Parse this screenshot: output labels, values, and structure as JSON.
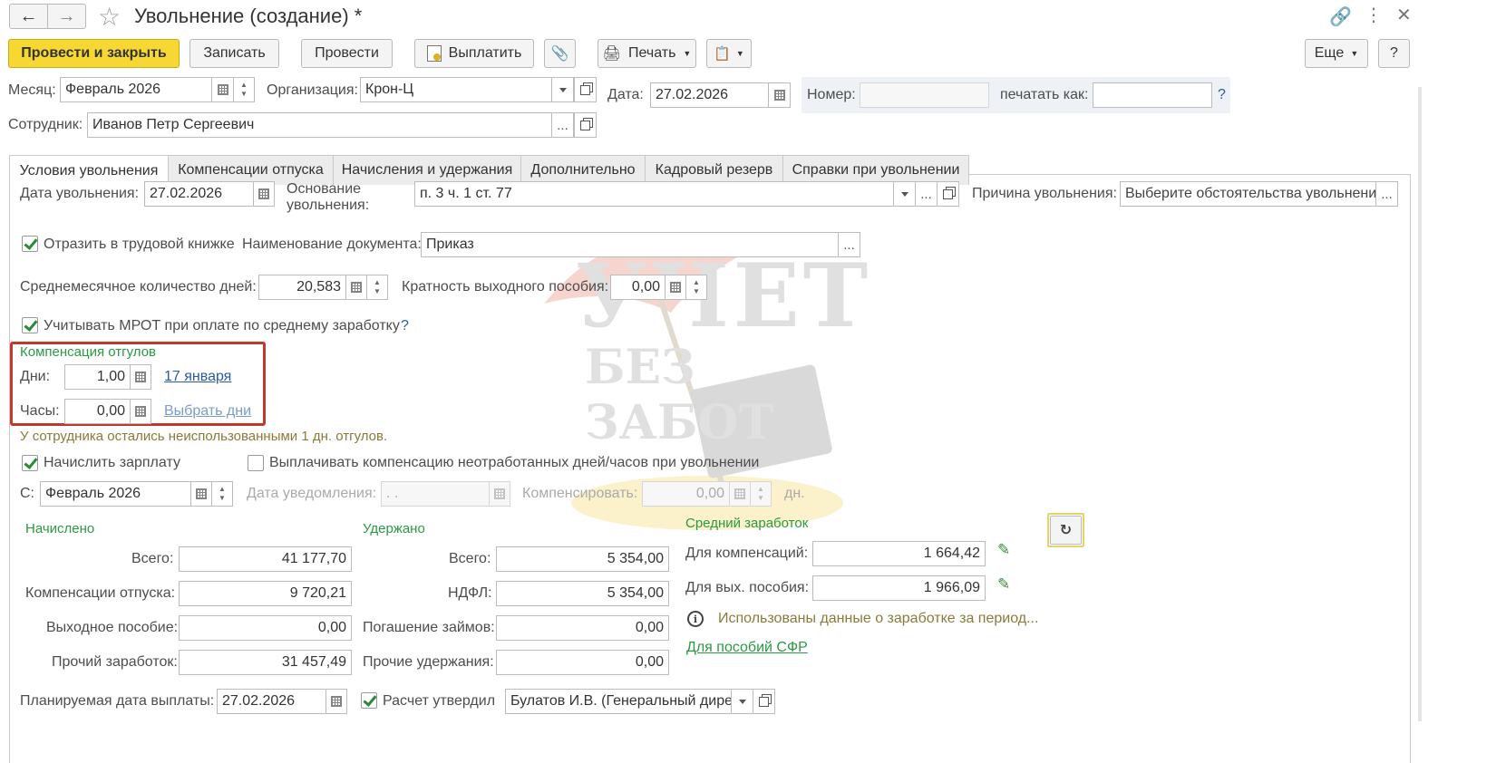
{
  "window": {
    "title": "Увольнение (создание) *",
    "back_icon": "arrow-left-icon",
    "forward_icon": "arrow-right-icon",
    "star_icon": "star-icon",
    "link_icon": "link-icon",
    "more_icon": "kebab-icon",
    "close_icon": "close-icon"
  },
  "toolbar": {
    "post_close": "Провести и закрыть",
    "save": "Записать",
    "post": "Провести",
    "pay": "Выплатить",
    "print": "Печать",
    "more": "Еще",
    "help": "?"
  },
  "header": {
    "month_label": "Месяц:",
    "month_value": "Февраль 2026",
    "org_label": "Организация:",
    "org_value": "Крон-Ц",
    "date_label": "Дата:",
    "date_value": "27.02.2026",
    "number_label": "Номер:",
    "number_value": "",
    "print_as_label": "печатать как:",
    "print_as_value": "",
    "help_q": "?",
    "employee_label": "Сотрудник:",
    "employee_value": "Иванов Петр Сергеевич",
    "ellipsis": "..."
  },
  "tabs": [
    {
      "label": "Условия увольнения",
      "active": true
    },
    {
      "label": "Компенсации отпуска",
      "active": false
    },
    {
      "label": "Начисления и удержания",
      "active": false
    },
    {
      "label": "Дополнительно",
      "active": false
    },
    {
      "label": "Кадровый резерв",
      "active": false
    },
    {
      "label": "Справки при увольнении",
      "active": false
    }
  ],
  "conditions": {
    "dismissal_date_label": "Дата увольнения:",
    "dismissal_date_value": "27.02.2026",
    "basis_label_1": "Основание",
    "basis_label_2": "увольнения:",
    "basis_value": "п. 3 ч. 1 ст. 77",
    "reason_label": "Причина увольнения:",
    "reason_value": "Выберите обстоятельства увольнения",
    "work_book_label": "Отразить в трудовой книжке",
    "work_book_checked": true,
    "doc_name_label": "Наименование документа:",
    "doc_name_value": "Приказ",
    "avg_days_label": "Среднемесячное количество дней:",
    "avg_days_value": "20,583",
    "severance_mult_label": "Кратность выходного пособия:",
    "severance_mult_value": "0,00",
    "mrot_label": "Учитывать МРОТ при оплате по среднему заработку",
    "mrot_checked": true,
    "mrot_help": "?"
  },
  "timeoff": {
    "title": "Компенсация отгулов",
    "days_label": "Дни:",
    "days_value": "1,00",
    "days_link": "17 января",
    "hours_label": "Часы:",
    "hours_value": "0,00",
    "hours_link": "Выбрать дни",
    "note": "У сотрудника остались неиспользованными 1 дн. отгулов.",
    "highlight_color": "#c0392b"
  },
  "salary": {
    "accrue_label": "Начислить зарплату",
    "accrue_checked": true,
    "pay_comp_label": "Выплачивать компенсацию неотработанных дней/часов при увольнении",
    "pay_comp_checked": false,
    "from_label": "С:",
    "from_value": "Февраль 2026",
    "notice_date_label": "Дата уведомления:",
    "notice_date_value": " .  .",
    "compensate_label": "Компенсировать:",
    "compensate_value": "0,00",
    "compensate_unit": "дн."
  },
  "accrued": {
    "title": "Начислено",
    "total_label": "Всего:",
    "total_value": "41 177,70",
    "vacation_label": "Компенсации отпуска:",
    "vacation_value": "9 720,21",
    "severance_label": "Выходное пособие:",
    "severance_value": "0,00",
    "other_label": "Прочий заработок:",
    "other_value": "31 457,49"
  },
  "withheld": {
    "title": "Удержано",
    "total_label": "Всего:",
    "total_value": "5 354,00",
    "ndfl_label": "НДФЛ:",
    "ndfl_value": "5 354,00",
    "loans_label": "Погашение займов:",
    "loans_value": "0,00",
    "other_label": "Прочие удержания:",
    "other_value": "0,00"
  },
  "average": {
    "title": "Средний заработок",
    "comp_label": "Для компенсаций:",
    "comp_value": "1 664,42",
    "sev_label": "Для вых. пособия:",
    "sev_value": "1 966,09",
    "info_text": "Использованы данные о заработке за период...",
    "sfr_link": "Для пособий СФР",
    "refresh_icon": "refresh-icon",
    "edit_icon": "pencil-icon"
  },
  "footer": {
    "planned_date_label": "Планируемая дата выплаты:",
    "planned_date_value": "27.02.2026",
    "approved_label": "Расчет утвердил",
    "approved_checked": true,
    "approved_value": "Булатов И.В. (Генеральный дире"
  },
  "watermark": {
    "line1": "УЧЕТ",
    "line2": "БЕЗ ЗАБОТ"
  }
}
